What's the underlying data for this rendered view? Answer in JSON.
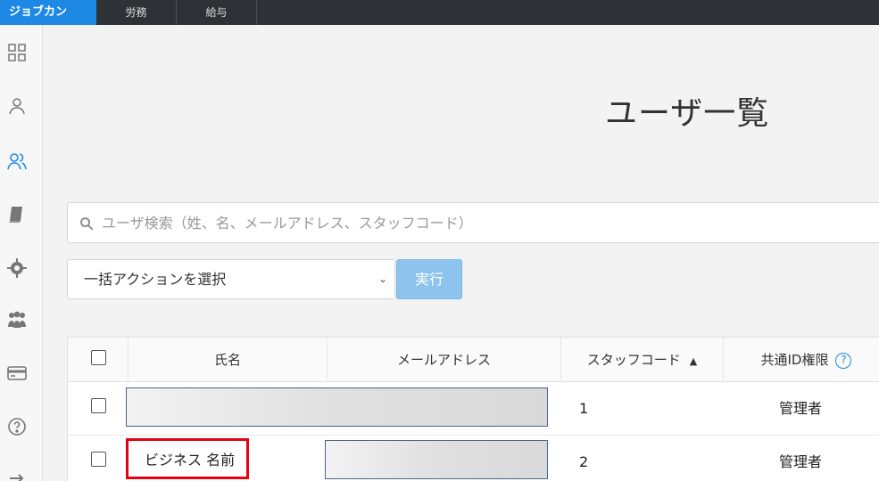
{
  "topbar": {
    "brand": "ジョブカン",
    "tabs": [
      "労務",
      "給与"
    ]
  },
  "sidebar": {
    "icons": [
      "dashboard-icon",
      "user-icon",
      "users-icon",
      "book-icon",
      "gear-icon",
      "group-icon",
      "card-icon",
      "help-icon",
      "logout-icon"
    ],
    "active": "users-icon",
    "accent": "#1e88e5"
  },
  "main": {
    "title": "ユーザ一覧",
    "search": {
      "placeholder": "ユーザ検索（姓、名、メールアドレス、スタッフコード）"
    },
    "bulk_action": {
      "selected": "一括アクションを選択"
    },
    "run_button": "実行"
  },
  "table": {
    "headers": {
      "name": "氏名",
      "email": "メールアドレス",
      "staff_code": "スタッフコード",
      "auth": "共通ID権限"
    },
    "rows": [
      {
        "name": "",
        "email": "",
        "staff_code": "1",
        "auth": "管理者"
      },
      {
        "name": "ビジネス 名前",
        "email": "",
        "staff_code": "2",
        "auth": "管理者"
      }
    ]
  },
  "colors": {
    "brand": "#1e88e5",
    "run_button": "#8dc3ec",
    "highlight": "#e60012"
  }
}
